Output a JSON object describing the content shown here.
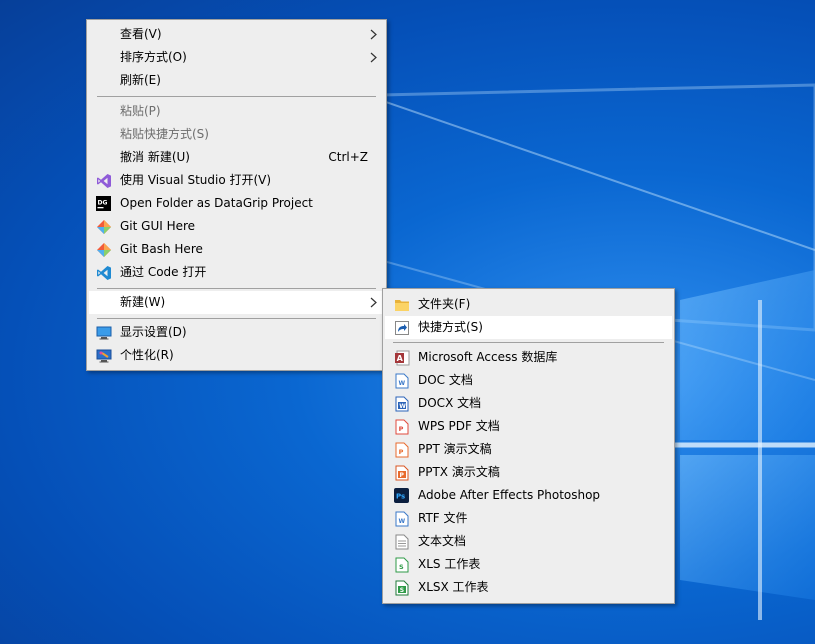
{
  "colors": {
    "menu_bg": "#eeeeee",
    "highlight": "#ffffff",
    "disabled_text": "#6d6d6d",
    "desktop": "#0a67d1"
  },
  "context_menu": {
    "view": "查看(V)",
    "sort_by": "排序方式(O)",
    "refresh": "刷新(E)",
    "paste": "粘贴(P)",
    "paste_shortcut": "粘贴快捷方式(S)",
    "undo_new": "撤消 新建(U)",
    "undo_shortcut": "Ctrl+Z",
    "open_vs": "使用 Visual Studio 打开(V)",
    "open_datagrip": "Open Folder as DataGrip Project",
    "git_gui": "Git GUI Here",
    "git_bash": "Git Bash Here",
    "open_code": "通过 Code 打开",
    "new": "新建(W)",
    "display_settings": "显示设置(D)",
    "personalize": "个性化(R)"
  },
  "new_submenu": {
    "folder": "文件夹(F)",
    "shortcut": "快捷方式(S)",
    "items": [
      {
        "label": "Microsoft Access 数据库",
        "icon": "access-icon"
      },
      {
        "label": "DOC 文档",
        "icon": "doc-icon"
      },
      {
        "label": "DOCX 文档",
        "icon": "docx-icon"
      },
      {
        "label": "WPS PDF 文档",
        "icon": "wps-pdf-icon"
      },
      {
        "label": "PPT 演示文稿",
        "icon": "ppt-icon"
      },
      {
        "label": "PPTX 演示文稿",
        "icon": "pptx-icon"
      },
      {
        "label": "Adobe After Effects Photoshop",
        "icon": "photoshop-icon"
      },
      {
        "label": "RTF 文件",
        "icon": "rtf-icon"
      },
      {
        "label": "文本文档",
        "icon": "text-document-icon"
      },
      {
        "label": "XLS 工作表",
        "icon": "xls-icon"
      },
      {
        "label": "XLSX 工作表",
        "icon": "xlsx-icon"
      }
    ]
  }
}
